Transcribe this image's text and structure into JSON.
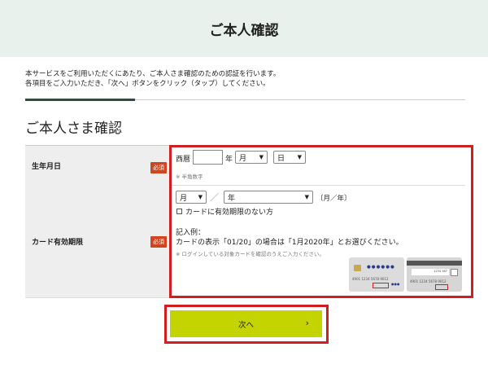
{
  "header": {
    "title": "ご本人確認"
  },
  "intro": {
    "line1": "本サービスをご利用いただくにあたり、ご本人さま確認のための認証を行います。",
    "line2": "各項目をご入力いただき、「次へ」ボタンをクリック（タップ）してください。"
  },
  "section_title": "ご本人さま確認",
  "birthdate": {
    "label": "生年月日",
    "required": "必須",
    "era": "西暦",
    "year_value": "",
    "year_unit": "年",
    "month_value": "月",
    "day_value": "日",
    "note": "※ 半角数字"
  },
  "expiry": {
    "label": "カード有効期限",
    "required": "必須",
    "month_value": "月",
    "year_value": "年",
    "format_hint": "〔月／年〕",
    "no_expiry_label": "カードに有効期限のない方",
    "example_heading": "記入例：",
    "example_text": "カードの表示「01/20」の場合は「1月2020年」とお選びください。",
    "login_note": "※ ログインしている対象カードを確認のうえご入力ください。",
    "card_front_dots": "●●●●●●",
    "card_front_number": "4901 1234 5678 9012",
    "card_back_code": "1234 567",
    "card_back_number": "4901 1234 5678 9012"
  },
  "next_button": {
    "label": "次へ",
    "chevron": "›"
  },
  "colors": {
    "header_bg": "#e9f1ec",
    "accent_line": "#2e4d3a",
    "required_badge": "#d0441e",
    "next_button": "#c3d400",
    "highlight_frame": "#d11f1f"
  }
}
